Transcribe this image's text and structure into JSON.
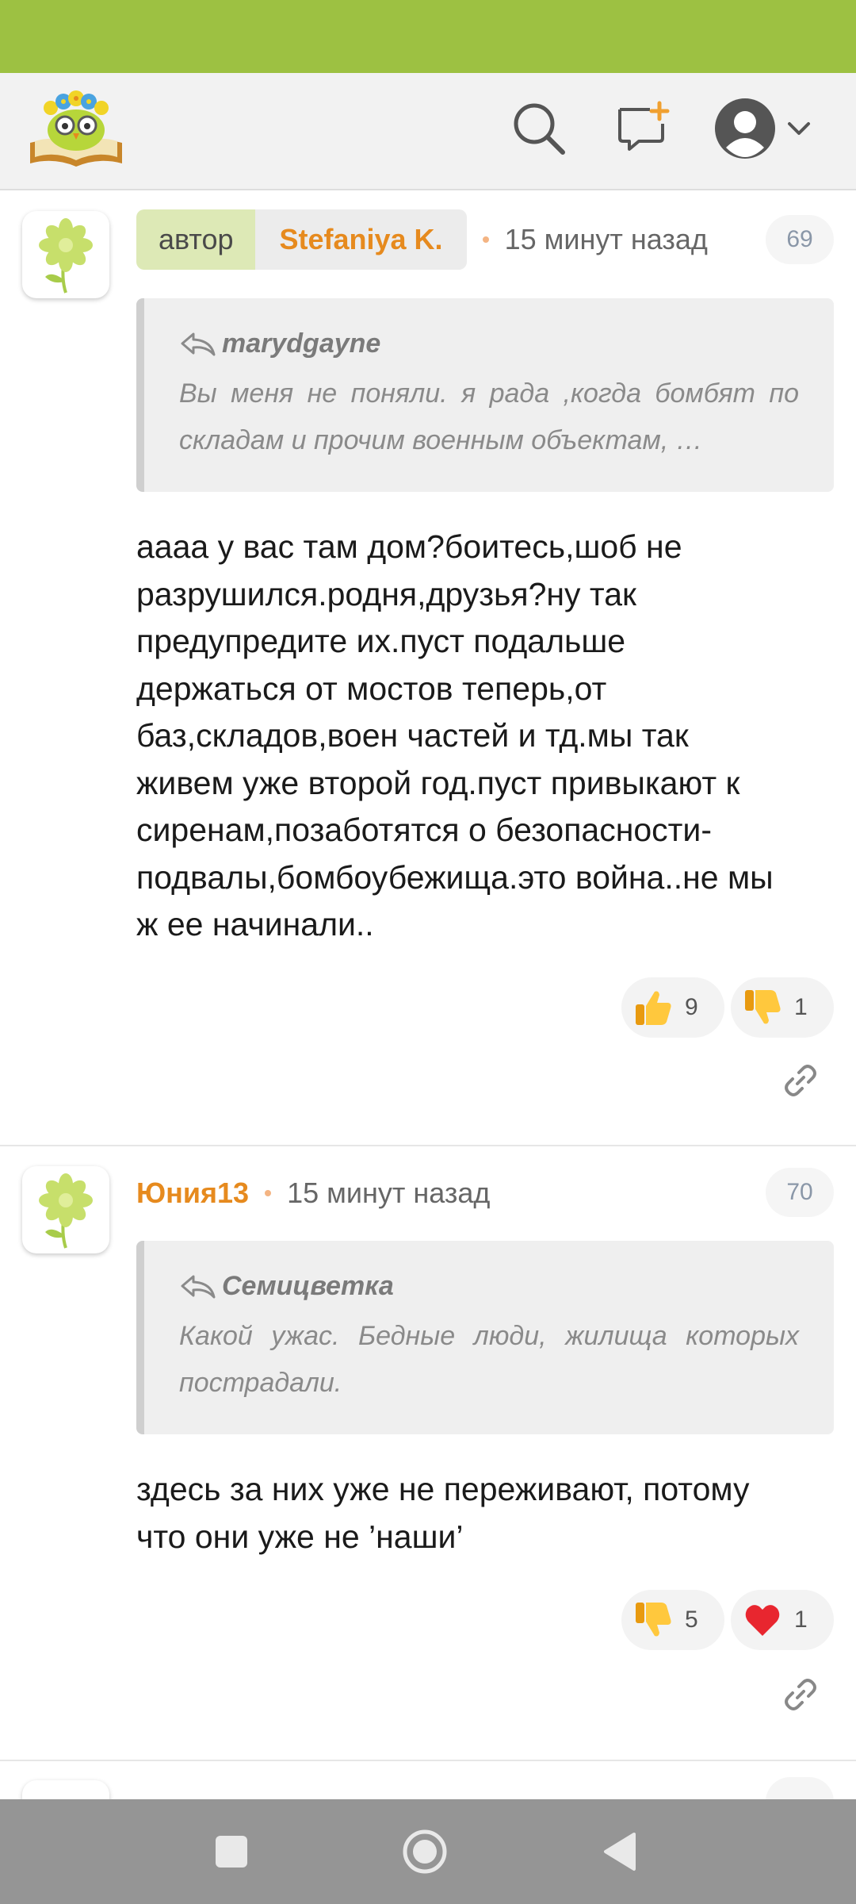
{
  "colors": {
    "status_bar": "#9dc142",
    "accent_orange": "#e68a1e",
    "author_tag_bg": "#dde9b6",
    "nav_bar": "#959595"
  },
  "header": {
    "logo_icon": "owl-with-flowers-on-book-logo",
    "search_icon": "search-icon",
    "new_post_icon": "chat-plus-icon",
    "profile_icon": "user-avatar-icon",
    "menu_icon": "chevron-down-icon"
  },
  "comments": [
    {
      "author_tag": "автор",
      "nickname": "Stefaniya K.",
      "time": "15 минут назад",
      "number": "69",
      "quote": {
        "author": "marydgayne",
        "text": "Вы меня не поняли. я рада ,когда бомбят по складам и прочим военным объектам, …"
      },
      "text": "аааа у вас там дом?боитесь,шоб не\nразрушился.родня,друзья?ну так\nпредупредите их.пуст подальше\nдержаться от мостов теперь,от\nбаз,складов,воен частей и тд.мы так\nживем уже второй год.пуст привыкают к\nсиренам,позаботятся о безопасности-\nподвалы,бомбоубежища.это война..не мы\nж ее начинали..",
      "reactions": [
        {
          "icon": "thumbs-up-icon",
          "count": "9"
        },
        {
          "icon": "thumbs-down-icon",
          "count": "1"
        }
      ]
    },
    {
      "nickname": "Юния13",
      "time": "15 минут назад",
      "number": "70",
      "quote": {
        "author": "Семицветка",
        "text": "Какой ужас. Бедные люди, жилища которых пострадали."
      },
      "text": "здесь за них уже не переживают, потому\nчто они уже не ’наши’",
      "reactions": [
        {
          "icon": "thumbs-down-icon",
          "count": "5"
        },
        {
          "icon": "heart-icon",
          "count": "1"
        }
      ]
    }
  ],
  "nav": {
    "recent_icon": "square-icon",
    "home_icon": "circle-icon",
    "back_icon": "triangle-back-icon"
  }
}
